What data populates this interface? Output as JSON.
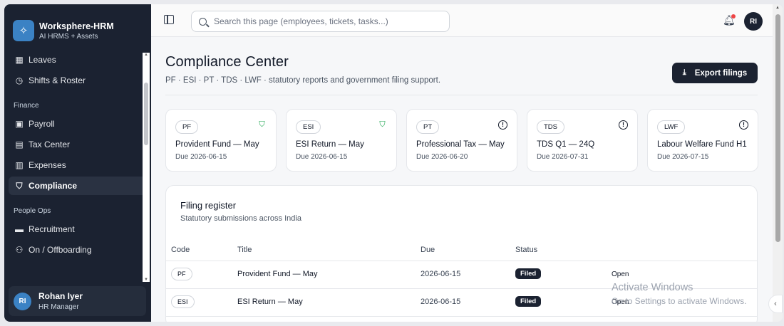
{
  "brand": {
    "name": "Worksphere-HRM",
    "subtitle": "AI HRMS + Assets"
  },
  "sidebar": {
    "items": [
      {
        "label": "Leaves",
        "icon": "calendar-icon"
      },
      {
        "label": "Shifts & Roster",
        "icon": "clock-icon"
      }
    ],
    "sections": [
      {
        "title": "Finance",
        "items": [
          {
            "label": "Payroll",
            "icon": "wallet-icon"
          },
          {
            "label": "Tax Center",
            "icon": "calculator-icon"
          },
          {
            "label": "Expenses",
            "icon": "receipt-icon"
          },
          {
            "label": "Compliance",
            "icon": "shield-icon",
            "active": true
          }
        ]
      },
      {
        "title": "People Ops",
        "items": [
          {
            "label": "Recruitment",
            "icon": "briefcase-icon"
          },
          {
            "label": "On / Offboarding",
            "icon": "user-plus-icon"
          }
        ]
      }
    ]
  },
  "user": {
    "initials": "RI",
    "name": "Rohan Iyer",
    "role": "HR Manager"
  },
  "topbar": {
    "search_placeholder": "Search this page (employees, tickets, tasks...)",
    "avatar_initials": "RI"
  },
  "page": {
    "title": "Compliance Center",
    "subtitle": "PF · ESI · PT · TDS · LWF · statutory reports and government filing support.",
    "export_label": "Export filings"
  },
  "cards": [
    {
      "code": "PF",
      "title": "Provident Fund — May",
      "due": "Due 2026-06-15",
      "status": "ok"
    },
    {
      "code": "ESI",
      "title": "ESI Return — May",
      "due": "Due 2026-06-15",
      "status": "ok"
    },
    {
      "code": "PT",
      "title": "Professional Tax — May",
      "due": "Due 2026-06-20",
      "status": "pending"
    },
    {
      "code": "TDS",
      "title": "TDS Q1 — 24Q",
      "due": "Due 2026-07-31",
      "status": "pending"
    },
    {
      "code": "LWF",
      "title": "Labour Welfare Fund H1",
      "due": "Due 2026-07-15",
      "status": "pending"
    }
  ],
  "register": {
    "title": "Filing register",
    "subtitle": "Statutory submissions across India",
    "columns": [
      "Code",
      "Title",
      "Due",
      "Status"
    ],
    "rows": [
      {
        "code": "PF",
        "title": "Provident Fund — May",
        "due": "2026-06-15",
        "status": "Filed",
        "action": "Open"
      },
      {
        "code": "ESI",
        "title": "ESI Return — May",
        "due": "2026-06-15",
        "status": "Filed",
        "action": "Open"
      }
    ]
  },
  "watermark": {
    "line1": "Activate Windows",
    "line2": "Go to Settings to activate Windows."
  },
  "colors": {
    "sidebar_bg": "#1b2231",
    "accent": "#3b82c4",
    "ok": "#16a34a",
    "notification": "#ef4444"
  }
}
